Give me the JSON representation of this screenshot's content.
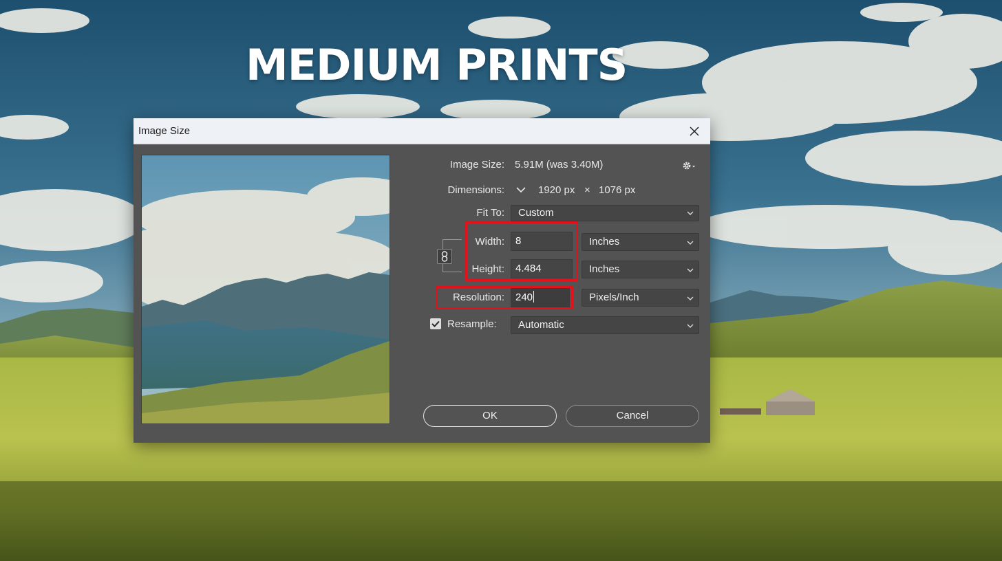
{
  "overlay": {
    "headline": "MEDIUM PRINTS"
  },
  "dialog": {
    "title": "Image Size",
    "image_size": {
      "label": "Image Size:",
      "value": "5.91M (was 3.40M)"
    },
    "dimensions": {
      "label": "Dimensions:",
      "width": "1920 px",
      "times": "×",
      "height": "1076 px"
    },
    "fit_to": {
      "label": "Fit To:",
      "value": "Custom"
    },
    "width": {
      "label": "Width:",
      "value": "8",
      "unit": "Inches"
    },
    "height": {
      "label": "Height:",
      "value": "4.484",
      "unit": "Inches"
    },
    "resolution": {
      "label": "Resolution:",
      "value": "240",
      "unit": "Pixels/Inch"
    },
    "resample": {
      "label": "Resample:",
      "checked": true,
      "value": "Automatic"
    },
    "buttons": {
      "ok": "OK",
      "cancel": "Cancel"
    }
  },
  "icons": {
    "close": "close-icon",
    "gear": "gear-icon",
    "chevron": "chevron-down-icon",
    "link": "link-icon",
    "check": "checkmark-icon"
  },
  "colors": {
    "highlight": "#e3121a",
    "dialog_bg": "#535353",
    "titlebar_bg": "#eef1f6"
  }
}
